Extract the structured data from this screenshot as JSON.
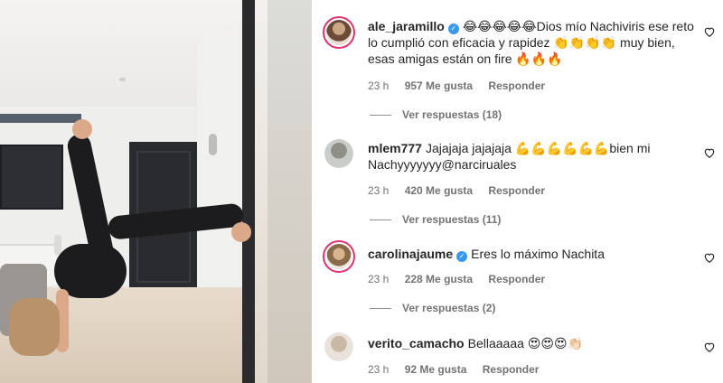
{
  "comments": [
    {
      "username": "ale_jaramillo",
      "verified": true,
      "text": "😂😂😂😂😂Dios mío Nachiviris ese reto lo cumplió con eficacia y rapidez 👏👏👏👏 muy bien, esas amigas están on fire 🔥🔥🔥",
      "time": "23 h",
      "likes": "957 Me gusta",
      "reply_label": "Responder",
      "view_replies": "Ver respuestas (18)"
    },
    {
      "username": "mlem777",
      "verified": false,
      "text": "Jajajaja jajajaja 💪💪💪💪💪💪bien mi Nachyyyyyyy@narciruales",
      "time": "23 h",
      "likes": "420 Me gusta",
      "reply_label": "Responder",
      "view_replies": "Ver respuestas (11)"
    },
    {
      "username": "carolinajaume",
      "verified": true,
      "text": "Eres lo máximo Nachita",
      "time": "23 h",
      "likes": "228 Me gusta",
      "reply_label": "Responder",
      "view_replies": "Ver respuestas (2)"
    },
    {
      "username": "verito_camacho",
      "verified": false,
      "text": "Bellaaaaa 😍😍😍👏🏻",
      "time": "23 h",
      "likes": "92 Me gusta",
      "reply_label": "Responder"
    }
  ],
  "icons": {
    "like": "heart-outline-icon",
    "verified": "verified-badge-icon"
  },
  "colors": {
    "verified": "#3897f0",
    "story_ring": "#e1306c",
    "meta_text": "#737373"
  }
}
